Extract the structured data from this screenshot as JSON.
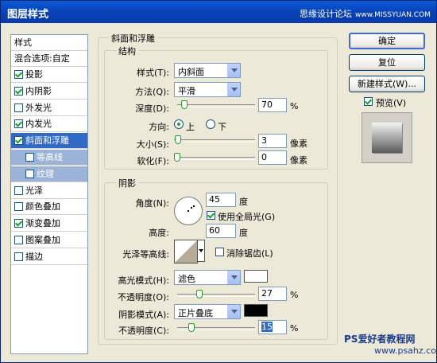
{
  "window": {
    "title": "图层样式",
    "watermark": "思缘设计论坛",
    "watermark_url": "www.MISSYUAN.COM"
  },
  "left_list": {
    "header": "样式",
    "blend_options": "混合选项:自定",
    "items": [
      {
        "label": "投影",
        "checked": true
      },
      {
        "label": "内阴影",
        "checked": true
      },
      {
        "label": "外发光",
        "checked": false
      },
      {
        "label": "内发光",
        "checked": true
      },
      {
        "label": "斜面和浮雕",
        "checked": true,
        "selected": true
      },
      {
        "label": "等高线",
        "checked": false,
        "sub": true
      },
      {
        "label": "纹理",
        "checked": false,
        "sub": true
      },
      {
        "label": "光泽",
        "checked": false
      },
      {
        "label": "颜色叠加",
        "checked": false
      },
      {
        "label": "渐变叠加",
        "checked": true
      },
      {
        "label": "图案叠加",
        "checked": false
      },
      {
        "label": "描边",
        "checked": false
      }
    ]
  },
  "bevel": {
    "group_title": "斜面和浮雕",
    "structure": {
      "title": "结构",
      "style_label": "样式(T):",
      "style_value": "内斜面",
      "method_label": "方法(Q):",
      "method_value": "平滑",
      "depth_label": "深度(D):",
      "depth_value": "70",
      "depth_unit": "%",
      "depth_level": 0.05,
      "direction_label": "方向:",
      "dir_up": "上",
      "dir_down": "下",
      "size_label": "大小(S):",
      "size_value": "3",
      "size_unit": "像素",
      "size_level": 0.01,
      "soften_label": "软化(F):",
      "soften_value": "0",
      "soften_unit": "像素",
      "soften_level": 0.0
    },
    "shading": {
      "title": "阴影",
      "angle_label": "角度(N):",
      "angle_value": "45",
      "angle_unit": "度",
      "global_light": "使用全局光(G)",
      "altitude_label": "高度:",
      "altitude_value": "60",
      "altitude_unit": "度",
      "gloss_label": "光泽等高线:",
      "antialias": "消除锯齿(L)",
      "highlight_mode_label": "高光模式(H):",
      "highlight_mode": "滤色",
      "highlight_color": "#ffffff",
      "h_opacity_label": "不透明度(O):",
      "h_opacity_value": "27",
      "h_opacity_unit": "%",
      "h_opacity_level": 0.27,
      "shadow_mode_label": "阴影模式(A):",
      "shadow_mode": "正片叠底",
      "shadow_color": "#000000",
      "s_opacity_label": "不透明度(C):",
      "s_opacity_value": "15",
      "s_opacity_unit": "%",
      "s_opacity_level": 0.15
    }
  },
  "buttons": {
    "ok": "确定",
    "reset": "复位",
    "new_style": "新建样式(W)...",
    "preview": "预览(V)"
  },
  "footer_watermark": {
    "line1": "PS爱好者教程网",
    "line2": "www.psahz.com"
  }
}
